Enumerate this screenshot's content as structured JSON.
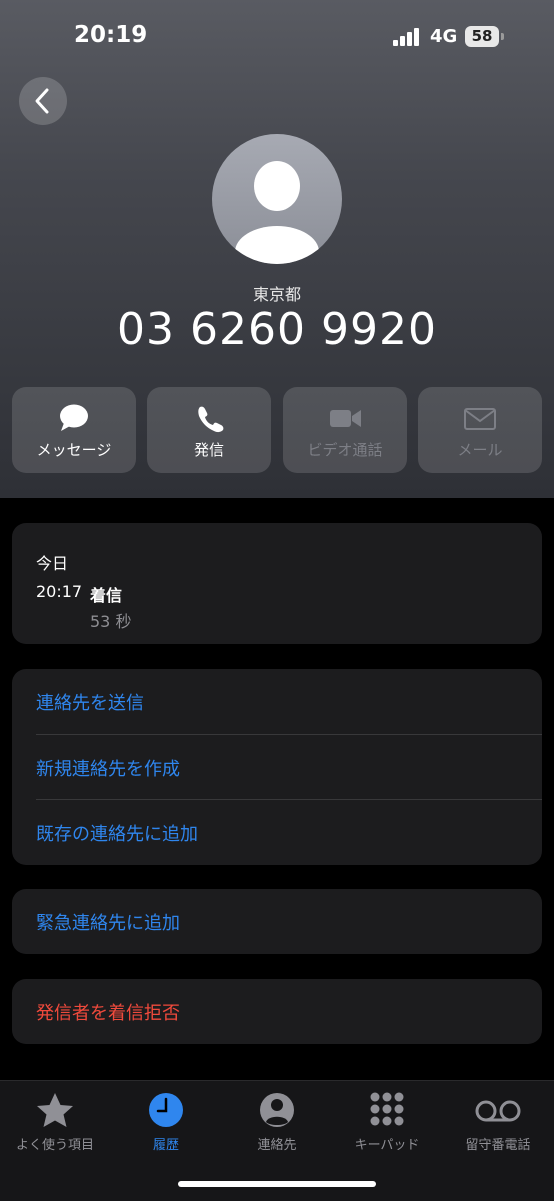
{
  "status_bar": {
    "time": "20:19",
    "network": "4G",
    "battery": "58"
  },
  "caller": {
    "location": "東京都",
    "number": "03 6260 9920"
  },
  "actions": [
    {
      "label": "メッセージ",
      "icon": "message-bubble-icon",
      "enabled": true
    },
    {
      "label": "発信",
      "icon": "phone-icon",
      "enabled": true
    },
    {
      "label": "ビデオ通話",
      "icon": "video-camera-icon",
      "enabled": false
    },
    {
      "label": "メール",
      "icon": "mail-icon",
      "enabled": false
    }
  ],
  "history": {
    "date": "今日",
    "time": "20:17",
    "type": "着信",
    "duration": "53 秒"
  },
  "contact_options": [
    "連絡先を送信",
    "新規連絡先を作成",
    "既存の連絡先に追加"
  ],
  "emergency_option": "緊急連絡先に追加",
  "block_option": "発信者を着信拒否",
  "colors": {
    "link_blue": "#2f86ee",
    "destructive_red": "#f04a3c",
    "card_bg": "#1c1c1e"
  },
  "tabs": [
    {
      "label": "よく使う項目",
      "icon": "star-icon",
      "active": false
    },
    {
      "label": "履歴",
      "icon": "clock-icon",
      "active": true
    },
    {
      "label": "連絡先",
      "icon": "person-circle-icon",
      "active": false
    },
    {
      "label": "キーパッド",
      "icon": "keypad-icon",
      "active": false
    },
    {
      "label": "留守番電話",
      "icon": "voicemail-icon",
      "active": false
    }
  ]
}
